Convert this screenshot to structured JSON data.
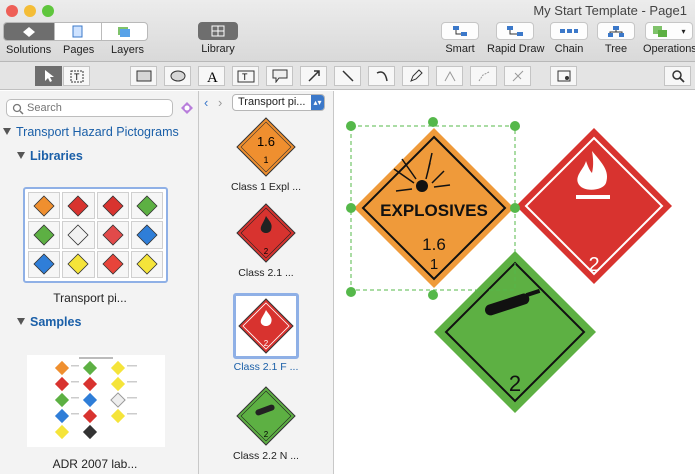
{
  "window": {
    "title": "My Start Template - Page1"
  },
  "toolbar_left": [
    {
      "id": "solutions",
      "label": "Solutions"
    },
    {
      "id": "pages",
      "label": "Pages"
    },
    {
      "id": "layers",
      "label": "Layers"
    }
  ],
  "library_button": {
    "label": "Library"
  },
  "toolbar_right": [
    {
      "id": "smart",
      "label": "Smart"
    },
    {
      "id": "rapid-draw",
      "label": "Rapid Draw"
    },
    {
      "id": "chain",
      "label": "Chain"
    },
    {
      "id": "tree",
      "label": "Tree"
    },
    {
      "id": "operations",
      "label": "Operations"
    }
  ],
  "search": {
    "placeholder": "Search"
  },
  "sidebar": {
    "root": "Transport Hazard Pictograms",
    "libraries_heading": "Libraries",
    "library_item": "Transport pi...",
    "samples_heading": "Samples",
    "sample_item": "ADR 2007 lab..."
  },
  "library_nav": {
    "selected": "Transport pi..."
  },
  "shapes": [
    {
      "label": "Class 1 Expl ...",
      "color": "#ef8f2f",
      "number": "1.6",
      "sub": "1",
      "selected": false
    },
    {
      "label": "Class 2.1 ...",
      "color": "#d8332f",
      "number": "2",
      "selected": false
    },
    {
      "label": "Class 2.1 F ...",
      "color": "#d8332f",
      "number": "2",
      "selected": true
    },
    {
      "label": "Class 2.2 N ...",
      "color": "#5db043",
      "number": "2",
      "selected": false
    }
  ],
  "canvas": {
    "explosives": {
      "text": "EXPLOSIVES",
      "division": "1.6",
      "class": "1",
      "color": "#ef9a3a"
    },
    "flammable": {
      "class": "2",
      "color": "#d8332f"
    },
    "nonflammable": {
      "class": "2",
      "color": "#5db043"
    }
  },
  "colors": {
    "accent": "#1a5fa8",
    "selection": "#55b84a"
  }
}
